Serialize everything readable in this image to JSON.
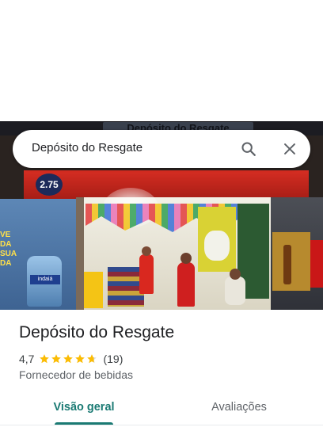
{
  "search": {
    "query": "Depósito do Resgate",
    "search_icon": "search-icon",
    "close_icon": "close-icon"
  },
  "photo": {
    "sign_text": "Depósito do Resgate",
    "banner_logo_text": "2.75",
    "left_wall_text": "VE DA SUA DA",
    "jug_label": "indaiá"
  },
  "place": {
    "title": "Depósito do Resgate",
    "rating": "4,7",
    "rating_stars": 4.7,
    "reviews_count": "(19)",
    "category": "Fornecedor de bebidas"
  },
  "tabs": [
    {
      "label": "Visão geral",
      "selected": true
    },
    {
      "label": "Avaliações",
      "selected": false
    }
  ],
  "colors": {
    "accent": "#1a7a73",
    "star": "#fbbc04",
    "star_empty": "#dadce0"
  }
}
